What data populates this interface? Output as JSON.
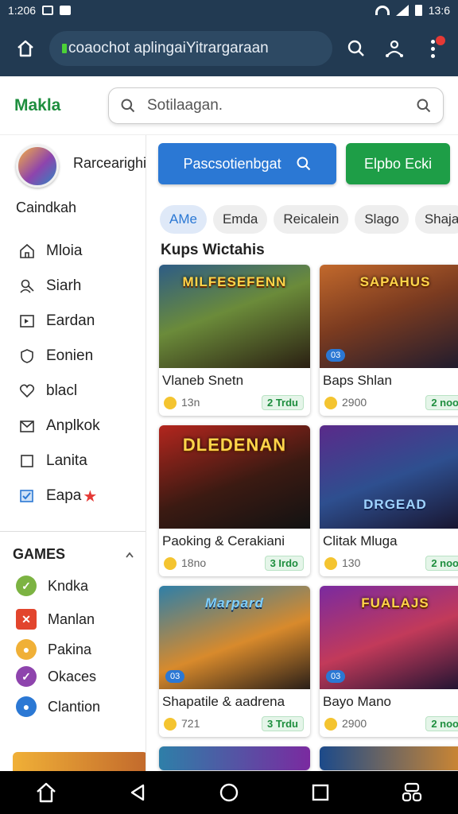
{
  "status_bar": {
    "time_left": "1:206",
    "time_right": "13:6"
  },
  "toolbar": {
    "url": "coaochot aplingaiYitrargaraan"
  },
  "header": {
    "brand": "Makla",
    "search_placeholder": "Sotilaagan."
  },
  "sidebar": {
    "profile_name": "Rarcearighi",
    "profile_sub": "Caindkah",
    "items": [
      {
        "label": "Mloia",
        "icon": "house-icon"
      },
      {
        "label": "Siarh",
        "icon": "user-search-icon"
      },
      {
        "label": "Eardan",
        "icon": "play-box-icon"
      },
      {
        "label": "Eonien",
        "icon": "shield-icon"
      },
      {
        "label": "blacl",
        "icon": "heart-icon"
      },
      {
        "label": "Anplkok",
        "icon": "mail-icon"
      },
      {
        "label": "Lanita",
        "icon": "square-icon"
      },
      {
        "label": "Eapa",
        "icon": "checkbox-icon"
      }
    ],
    "games_heading": "GAMES",
    "games": [
      {
        "label": "Kndka",
        "color": "#7cb342"
      },
      {
        "label": "Manlan",
        "color": "#e2452d"
      },
      {
        "label": "Pakina",
        "color": "#f0b037"
      },
      {
        "label": "Okaces",
        "color": "#8e44ad"
      },
      {
        "label": "Clantion",
        "color": "#2b78d4"
      }
    ]
  },
  "main": {
    "cta_primary": "Pascsotienbgat",
    "cta_secondary": "Elpbo Ecki",
    "chips": [
      "AMe",
      "Emda",
      "Reicalein",
      "Slago",
      "Shaja"
    ],
    "section_title": "Kups Wictahis",
    "cards": [
      {
        "art_title": "MILFESEFENN",
        "title": "Vlaneb Snetn",
        "meta": "13n",
        "badge": "2 Trdu",
        "tag": "",
        "bg": "linear-gradient(160deg,#2d5c86 0%,#6b8b3a 45%,#2a1f12 100%)"
      },
      {
        "art_title": "SAPAHUS",
        "title": "Baps Shlan",
        "meta": "2900",
        "badge": "2 noo",
        "tag": "03",
        "bg": "linear-gradient(160deg,#c2692c 0%,#7b3b20 45%,#1c1a2e 100%)"
      },
      {
        "art_title": "DLEDENAN",
        "title": "Paoking & Cerakiani",
        "meta": "18no",
        "badge": "3 Irdo",
        "tag": "",
        "bg": "linear-gradient(160deg,#b3261e 0%,#3b1a12 55%,#121212 100%)"
      },
      {
        "art_title": "DRGEAD",
        "title": "Clitak Mluga",
        "meta": "130",
        "badge": "2 noo",
        "tag": "",
        "bg": "linear-gradient(160deg,#5a2a8a 0%,#2e4f8f 50%,#17122b 100%)"
      },
      {
        "art_title": "Marpard",
        "title": "Shapatile & aadrena",
        "meta": "721",
        "badge": "3 Trdu",
        "tag": "03",
        "bg": "linear-gradient(160deg,#2e7fa8 0%,#d88a2c 55%,#2a1f18 100%)"
      },
      {
        "art_title": "FUALAJS",
        "title": "Bayo Mano",
        "meta": "2900",
        "badge": "2 noo",
        "tag": "03",
        "bg": "linear-gradient(160deg,#7a2aa0 0%,#c23a5a 50%,#1a1230 100%)"
      }
    ]
  }
}
